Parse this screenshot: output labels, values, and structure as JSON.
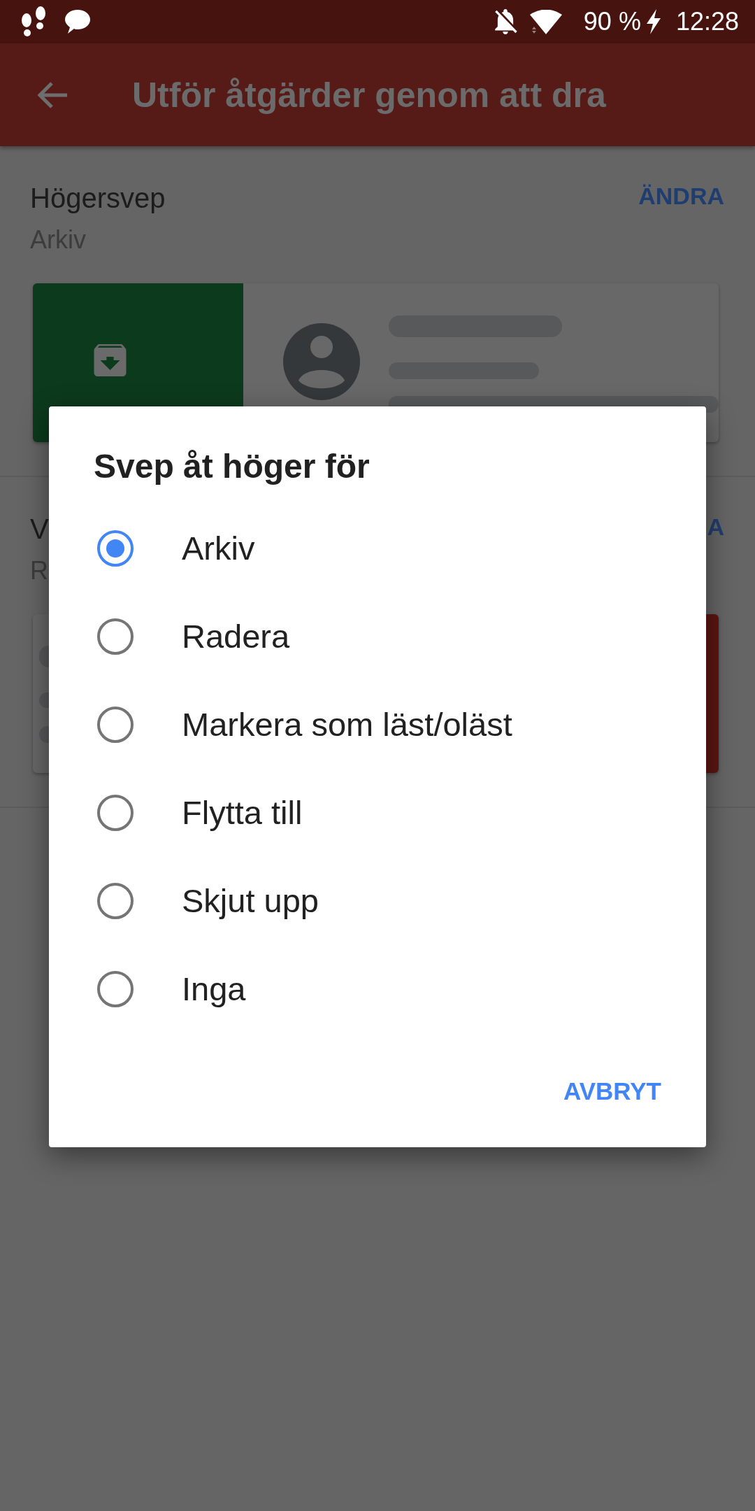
{
  "status_bar": {
    "battery": "90 %",
    "time": "12:28"
  },
  "app_bar": {
    "title": "Utför åtgärder genom att dra"
  },
  "sections": [
    {
      "kind": "action_left",
      "title": "Högersvep",
      "value": "Arkiv",
      "button": "ÄNDRA",
      "color": "#0c3a1c"
    },
    {
      "kind": "action_right",
      "title": "V",
      "value": "R",
      "button": "A",
      "color": "#5c1612"
    }
  ],
  "dialog": {
    "title": "Svep åt höger för",
    "options": [
      {
        "label": "Arkiv",
        "selected": true
      },
      {
        "label": "Radera",
        "selected": false
      },
      {
        "label": "Markera som läst/oläst",
        "selected": false
      },
      {
        "label": "Flytta till",
        "selected": false
      },
      {
        "label": "Skjut upp",
        "selected": false
      },
      {
        "label": "Inga",
        "selected": false
      }
    ],
    "buttons": [
      "AVBRYT"
    ]
  }
}
